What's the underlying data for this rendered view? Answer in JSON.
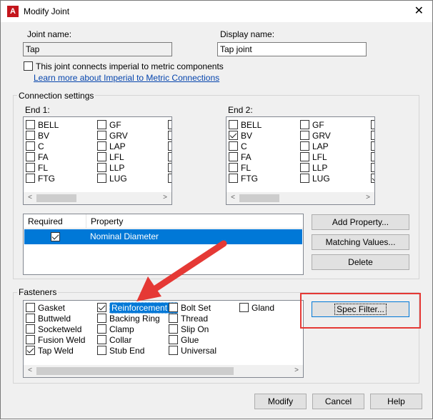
{
  "window": {
    "title": "Modify Joint",
    "app_icon_text": "A",
    "close_glyph": "✕"
  },
  "joint_name": {
    "label": "Joint name:",
    "value": "Tap"
  },
  "display_name": {
    "label": "Display name:",
    "value": "Tap joint"
  },
  "imperial_metric": {
    "checkbox_label": "This joint connects imperial to metric components",
    "checked": false,
    "link": "Learn more about Imperial to Metric Connections"
  },
  "connection_settings": {
    "title": "Connection settings",
    "end1": {
      "label": "End 1:",
      "col1": [
        {
          "label": "BELL",
          "checked": false
        },
        {
          "label": "BV",
          "checked": false
        },
        {
          "label": "C",
          "checked": false
        },
        {
          "label": "FA",
          "checked": false
        },
        {
          "label": "FL",
          "checked": false
        },
        {
          "label": "FTG",
          "checked": false
        }
      ],
      "col2": [
        {
          "label": "GF",
          "checked": false
        },
        {
          "label": "GRV",
          "checked": false
        },
        {
          "label": "LAP",
          "checked": false
        },
        {
          "label": "LFL",
          "checked": false
        },
        {
          "label": "LLP",
          "checked": false
        },
        {
          "label": "LUG",
          "checked": false
        }
      ]
    },
    "end2": {
      "label": "End 2:",
      "col1": [
        {
          "label": "BELL",
          "checked": false
        },
        {
          "label": "BV",
          "checked": true
        },
        {
          "label": "C",
          "checked": false
        },
        {
          "label": "FA",
          "checked": false
        },
        {
          "label": "FL",
          "checked": false
        },
        {
          "label": "FTG",
          "checked": false
        }
      ],
      "col2": [
        {
          "label": "GF",
          "checked": false
        },
        {
          "label": "GRV",
          "checked": false
        },
        {
          "label": "LAP",
          "checked": false
        },
        {
          "label": "LFL",
          "checked": false
        },
        {
          "label": "LLP",
          "checked": false
        },
        {
          "label": "LUG",
          "checked": false
        }
      ]
    },
    "table": {
      "headers": [
        "Required",
        "Property"
      ],
      "rows": [
        {
          "required": true,
          "property": "Nominal Diameter"
        }
      ]
    },
    "buttons": {
      "add_property": "Add Property...",
      "matching_values": "Matching Values...",
      "delete": "Delete"
    }
  },
  "fasteners": {
    "title": "Fasteners",
    "col1": [
      {
        "label": "Gasket",
        "checked": false
      },
      {
        "label": "Buttweld",
        "checked": false
      },
      {
        "label": "Socketweld",
        "checked": false
      },
      {
        "label": "Fusion Weld",
        "checked": false
      },
      {
        "label": "Tap Weld",
        "checked": true
      }
    ],
    "col2": [
      {
        "label": "Reinforcement R",
        "checked": true,
        "selected": true
      },
      {
        "label": "Backing Ring",
        "checked": false
      },
      {
        "label": "Clamp",
        "checked": false
      },
      {
        "label": "Collar",
        "checked": false
      },
      {
        "label": "Stub End",
        "checked": false
      }
    ],
    "col3": [
      {
        "label": "Bolt Set",
        "checked": false
      },
      {
        "label": "Thread",
        "checked": false
      },
      {
        "label": "Slip On",
        "checked": false
      },
      {
        "label": "Glue",
        "checked": false
      },
      {
        "label": "Universal",
        "checked": false
      }
    ],
    "col4": [
      {
        "label": "Gland",
        "checked": false
      }
    ],
    "spec_filter": "Spec Filter..."
  },
  "footer": {
    "modify": "Modify",
    "cancel": "Cancel",
    "help": "Help"
  },
  "scroll_arrows": {
    "left": "<",
    "right": ">"
  },
  "colors": {
    "accent": "#0078d7",
    "annotation": "#e53935",
    "title_icon": "#c4151c"
  }
}
